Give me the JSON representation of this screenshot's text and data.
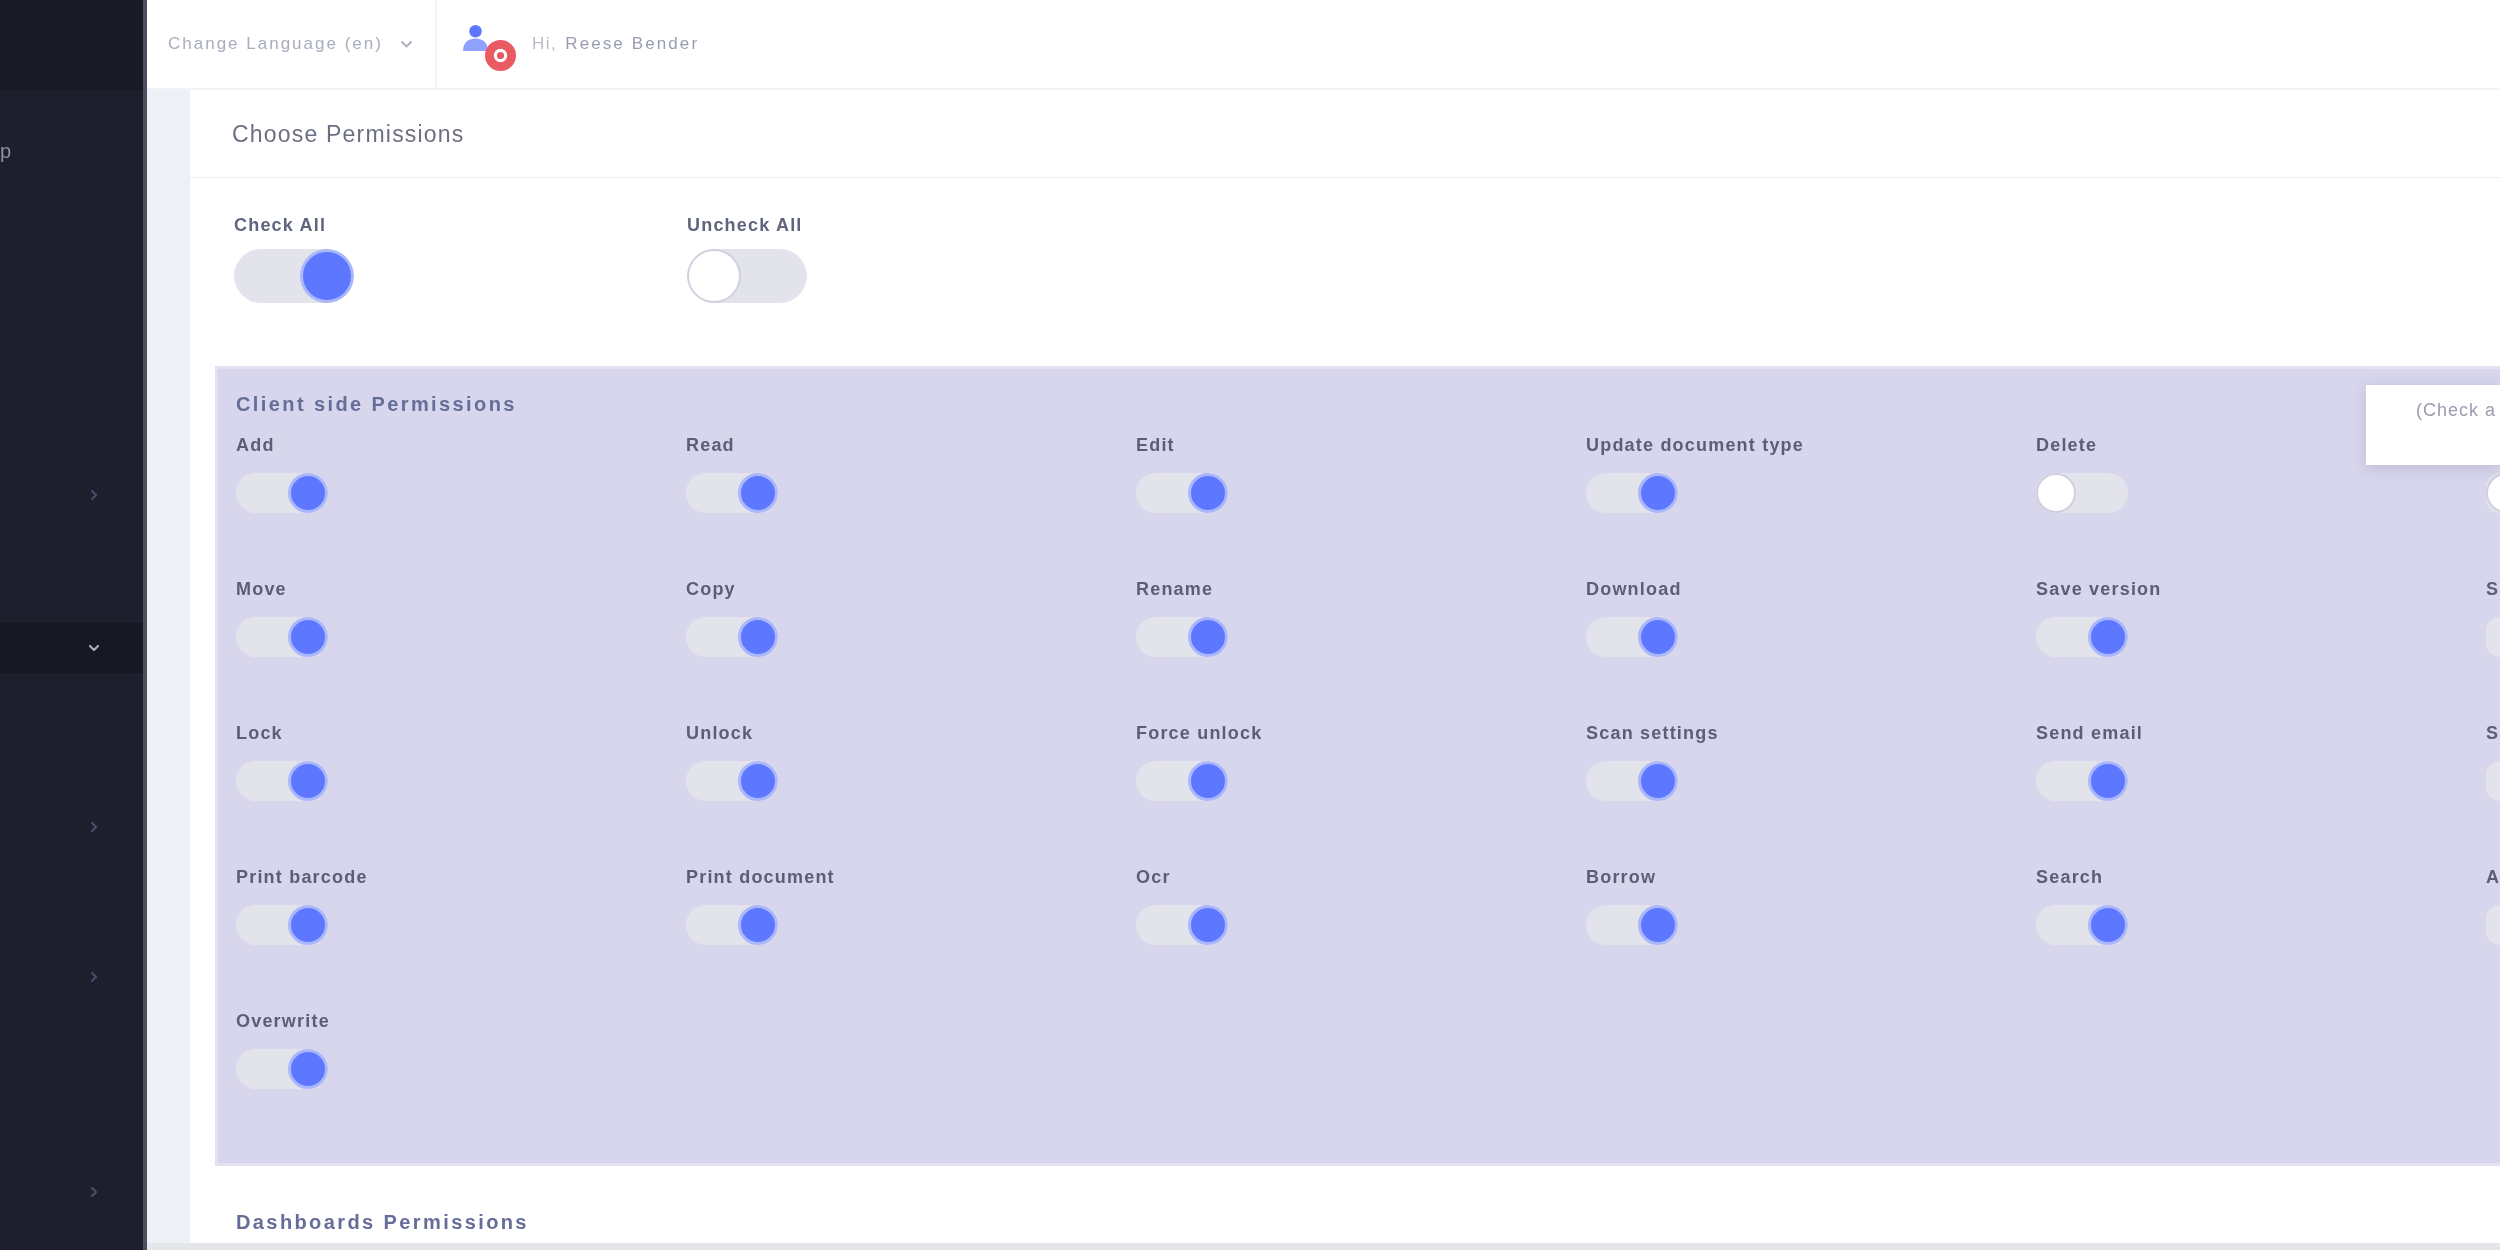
{
  "sidebar": {
    "items": [
      {
        "label": "p",
        "selected": false
      },
      {
        "expanded": false,
        "selected": false
      },
      {
        "expanded": true,
        "selected": true
      },
      {
        "expanded": false,
        "selected": false
      },
      {
        "expanded": false,
        "selected": false
      },
      {
        "expanded": false,
        "selected": false
      }
    ]
  },
  "topbar": {
    "language_select": {
      "label": "Change Language (en)"
    },
    "user": {
      "greeting": "Hi,",
      "name": "Reese Bender"
    }
  },
  "card": {
    "title": "Choose Permissions",
    "bulk_toggles": [
      {
        "label": "Check All",
        "checked": true
      },
      {
        "label": "Uncheck All",
        "checked": false
      }
    ],
    "sections": [
      {
        "title": "Client side Permissions",
        "highlighted": true,
        "tooltip": {
          "text": "(Check a"
        },
        "permissions": [
          {
            "label": "Add",
            "checked": true
          },
          {
            "label": "Read",
            "checked": true
          },
          {
            "label": "Edit",
            "checked": true
          },
          {
            "label": "Update document type",
            "checked": true
          },
          {
            "label": "Delete",
            "checked": false
          },
          {
            "checked": false
          },
          {
            "label": "Move",
            "checked": true
          },
          {
            "label": "Copy",
            "checked": true
          },
          {
            "label": "Rename",
            "checked": true
          },
          {
            "label": "Download",
            "checked": true
          },
          {
            "label": "Save version",
            "checked": true
          },
          {
            "label": "S",
            "checked": true
          },
          {
            "label": "Lock",
            "checked": true
          },
          {
            "label": "Unlock",
            "checked": true
          },
          {
            "label": "Force unlock",
            "checked": true
          },
          {
            "label": "Scan settings",
            "checked": true
          },
          {
            "label": "Send email",
            "checked": true
          },
          {
            "label": "S",
            "checked": true
          },
          {
            "label": "Print barcode",
            "checked": true
          },
          {
            "label": "Print document",
            "checked": true
          },
          {
            "label": "Ocr",
            "checked": true
          },
          {
            "label": "Borrow",
            "checked": true
          },
          {
            "label": "Search",
            "checked": true
          },
          {
            "label": "A",
            "checked": true
          },
          {
            "label": "Overwrite",
            "checked": true
          }
        ]
      },
      {
        "title": "Dashboards Permissions",
        "highlighted": false
      }
    ]
  }
}
